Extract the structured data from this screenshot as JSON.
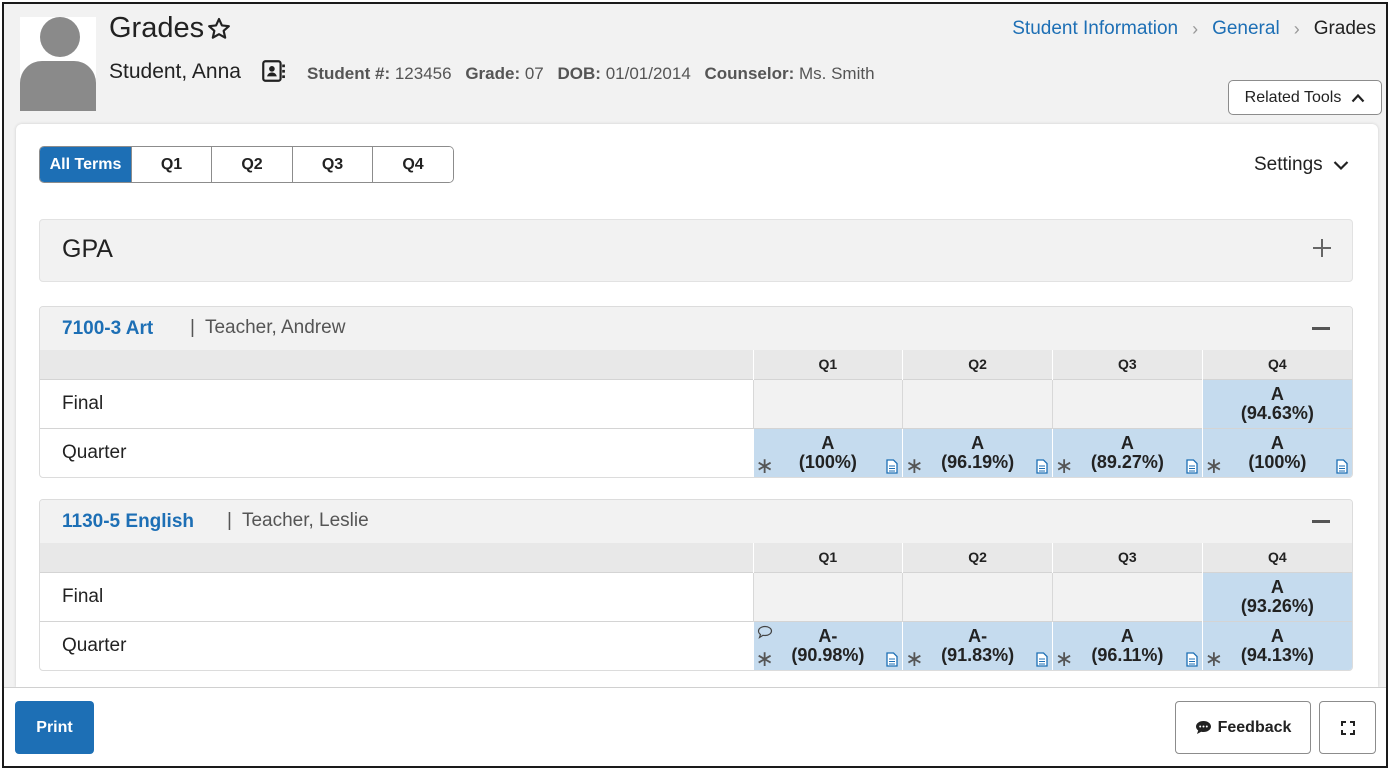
{
  "header": {
    "title": "Grades",
    "student_name": "Student, Anna",
    "student_number_label": "Student #:",
    "student_number": "123456",
    "grade_label": "Grade:",
    "grade": "07",
    "dob_label": "DOB:",
    "dob": "01/01/2014",
    "counselor_label": "Counselor:",
    "counselor": "Ms. Smith"
  },
  "breadcrumb": {
    "items": [
      "Student Information",
      "General",
      "Grades"
    ]
  },
  "related_tools": {
    "label": "Related Tools"
  },
  "terms": {
    "tabs": [
      "All Terms",
      "Q1",
      "Q2",
      "Q3",
      "Q4"
    ],
    "active": "All Terms"
  },
  "settings": {
    "label": "Settings"
  },
  "gpa": {
    "title": "GPA"
  },
  "columns": [
    "Q1",
    "Q2",
    "Q3",
    "Q4"
  ],
  "courses": [
    {
      "name": "7100-3 Art",
      "teacher": "Teacher, Andrew",
      "rows": [
        {
          "label": "Final",
          "cells": [
            null,
            null,
            null,
            {
              "grade": "A",
              "percent": "(94.63%)"
            }
          ]
        },
        {
          "label": "Quarter",
          "cells": [
            {
              "grade": "A",
              "percent": "(100%)"
            },
            {
              "grade": "A",
              "percent": "(96.19%)"
            },
            {
              "grade": "A",
              "percent": "(89.27%)"
            },
            {
              "grade": "A",
              "percent": "(100%)"
            }
          ]
        }
      ]
    },
    {
      "name": "1130-5 English",
      "teacher": "Teacher, Leslie",
      "rows": [
        {
          "label": "Final",
          "cells": [
            null,
            null,
            null,
            {
              "grade": "A",
              "percent": "(93.26%)"
            }
          ]
        },
        {
          "label": "Quarter",
          "cells": [
            {
              "grade": "A-",
              "percent": "(90.98%)"
            },
            {
              "grade": "A-",
              "percent": "(91.83%)"
            },
            {
              "grade": "A",
              "percent": "(96.11%)"
            },
            {
              "grade": "A",
              "percent": "(94.13%)"
            }
          ]
        }
      ]
    }
  ],
  "footer": {
    "print_label": "Print",
    "feedback_label": "Feedback"
  },
  "colors": {
    "link": "#1d6fb5",
    "grade_cell": "#c5dbee",
    "primary_button": "#1d6fb5"
  }
}
